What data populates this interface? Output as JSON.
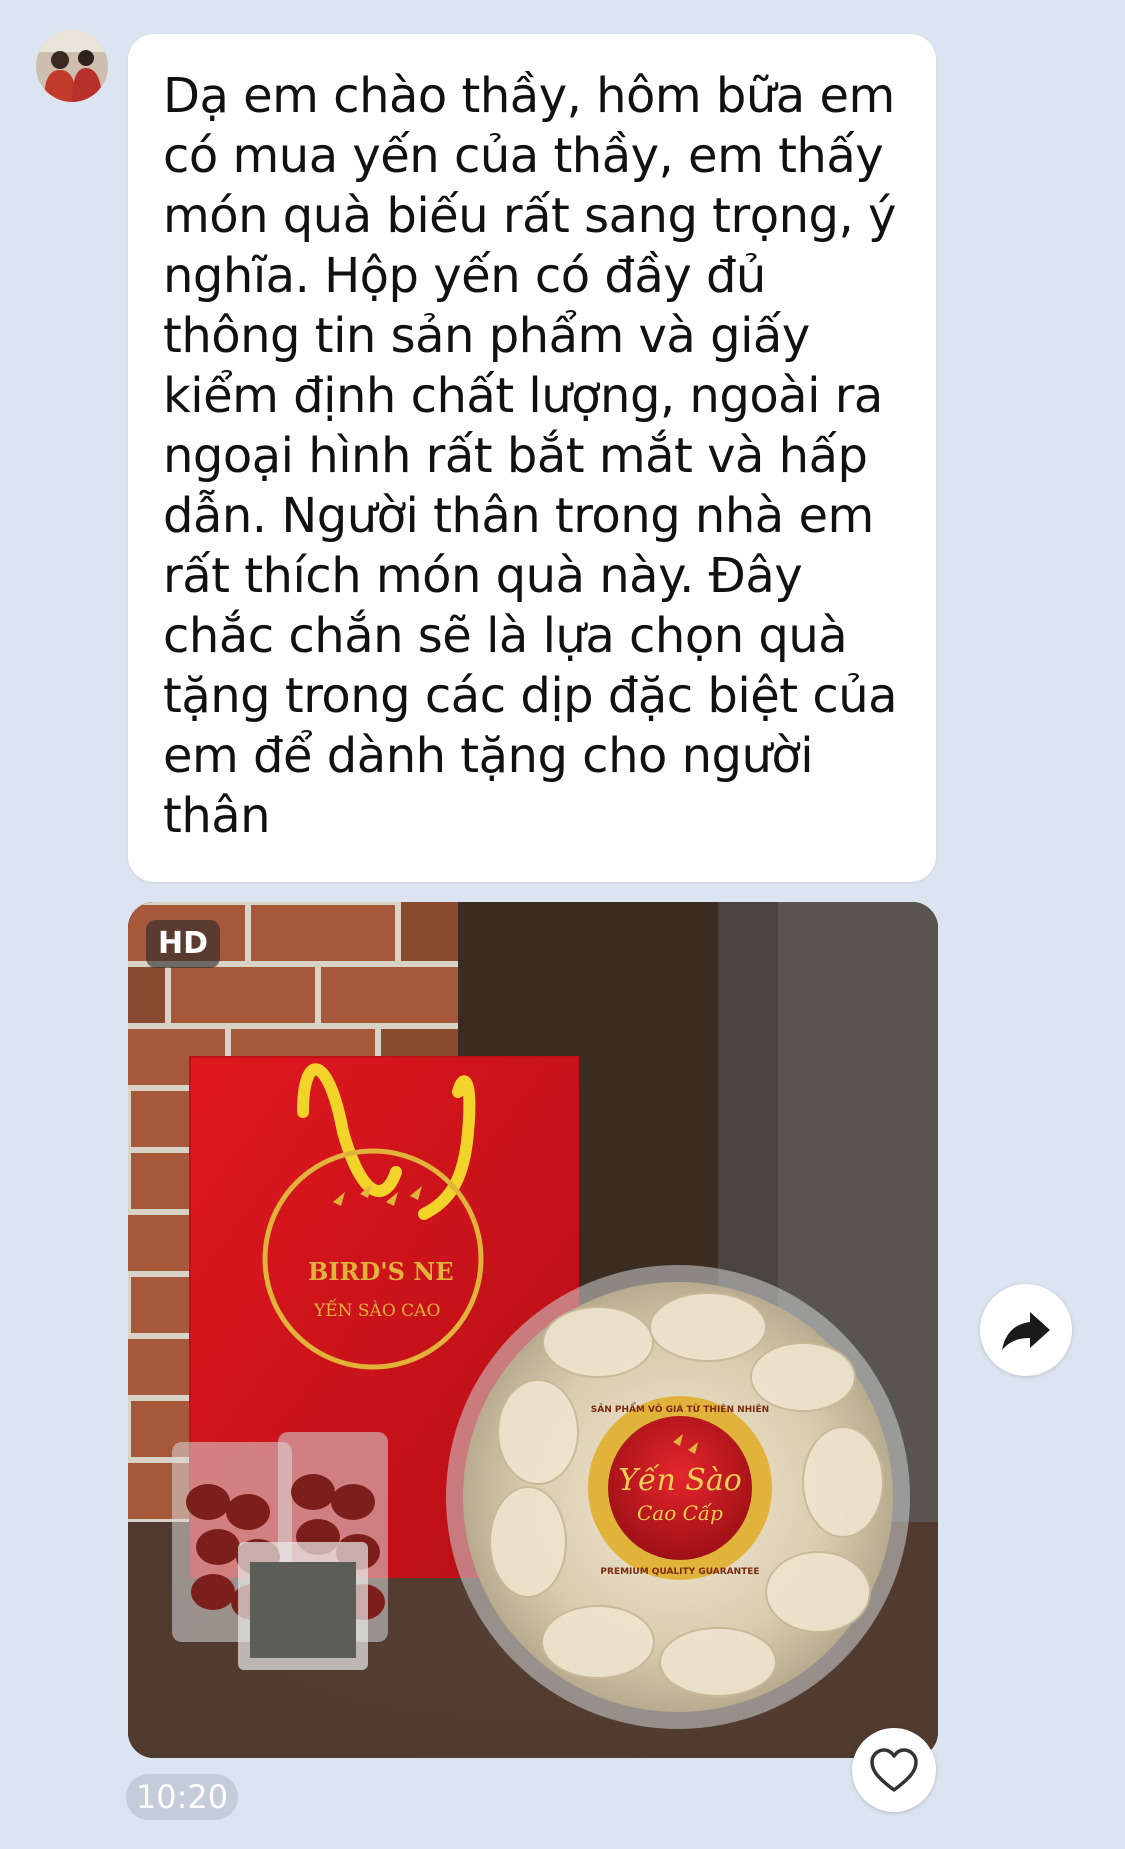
{
  "message": {
    "text": "Dạ em chào thầy, hôm bữa em\ncó mua yến của thầy, em thấy\nmón quà biếu rất sang trọng, ý\nnghĩa. Hộp yến có đầy đủ\nthông tin sản phẩm và giấy\nkiểm định chất lượng, ngoài ra\nngoại hình rất bắt mắt và hấp\ndẫn. Người thân trong nhà em\nrất thích món quà này. Đây\nchắc chắn sẽ là lựa chọn quà\ntặng trong các dịp đặc biệt của\nem để dành tặng cho người\nthân"
  },
  "photo": {
    "badge": "HD",
    "bag_logo_line1": "BIRD'S NE",
    "bag_logo_line2": "YẾN SÀO CAO",
    "seal_ring_top": "SẢN PHẨM VÔ GIÁ TỪ THIÊN NHIÊN",
    "seal_ring_bottom": "PREMIUM QUALITY GUARANTEE",
    "seal_title": "Yến Sào",
    "seal_subtitle": "Cao Cấp"
  },
  "timestamp": "10:20",
  "icons": {
    "share": "share-icon",
    "like": "heart-icon"
  },
  "colors": {
    "background": "#dbe4f0",
    "bubble": "#ffffff",
    "bag_red": "#d8141c",
    "gold": "#e2b33a"
  }
}
